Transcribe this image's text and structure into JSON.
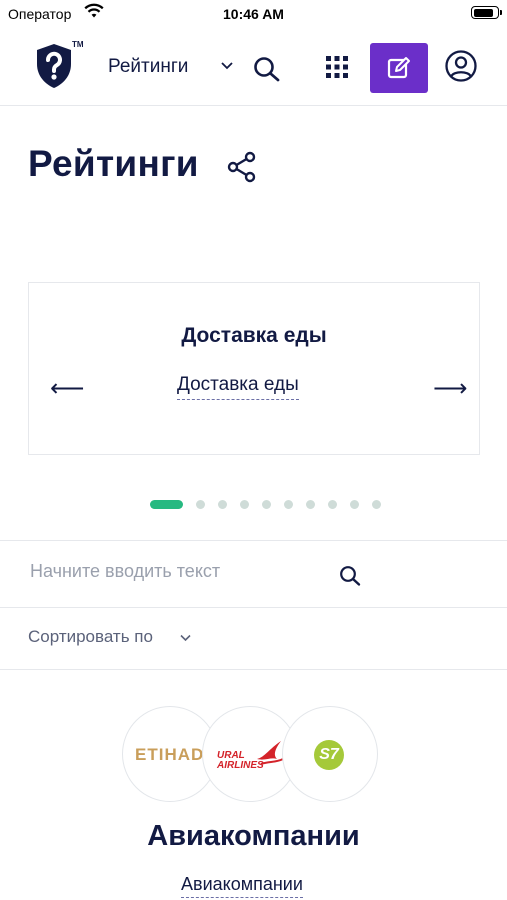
{
  "status_bar": {
    "carrier": "Оператор",
    "time": "10:46 AM"
  },
  "header": {
    "section": "Рейтинги",
    "accent_color": "#6b2fc9",
    "icons": [
      "shield-question-logo",
      "chevron-down-icon",
      "search-icon",
      "grid-icon",
      "edit-icon",
      "user-icon"
    ]
  },
  "page": {
    "title": "Рейтинги"
  },
  "carousel": {
    "heading": "Доставка еды",
    "link": "Доставка еды",
    "prev_arrow": "⟵",
    "next_arrow": "⟶",
    "total_slides": 10,
    "active_index": 0,
    "active_color": "#27b981"
  },
  "search": {
    "placeholder": "Начните вводить текст"
  },
  "sort": {
    "label": "Сортировать по"
  },
  "category": {
    "logos": {
      "etihad": "ETIHAD",
      "ural_line1": "URAL",
      "ural_line2": "AIRLINES",
      "s7": "S7"
    },
    "title": "Авиакомпании",
    "link": "Авиакомпании"
  }
}
